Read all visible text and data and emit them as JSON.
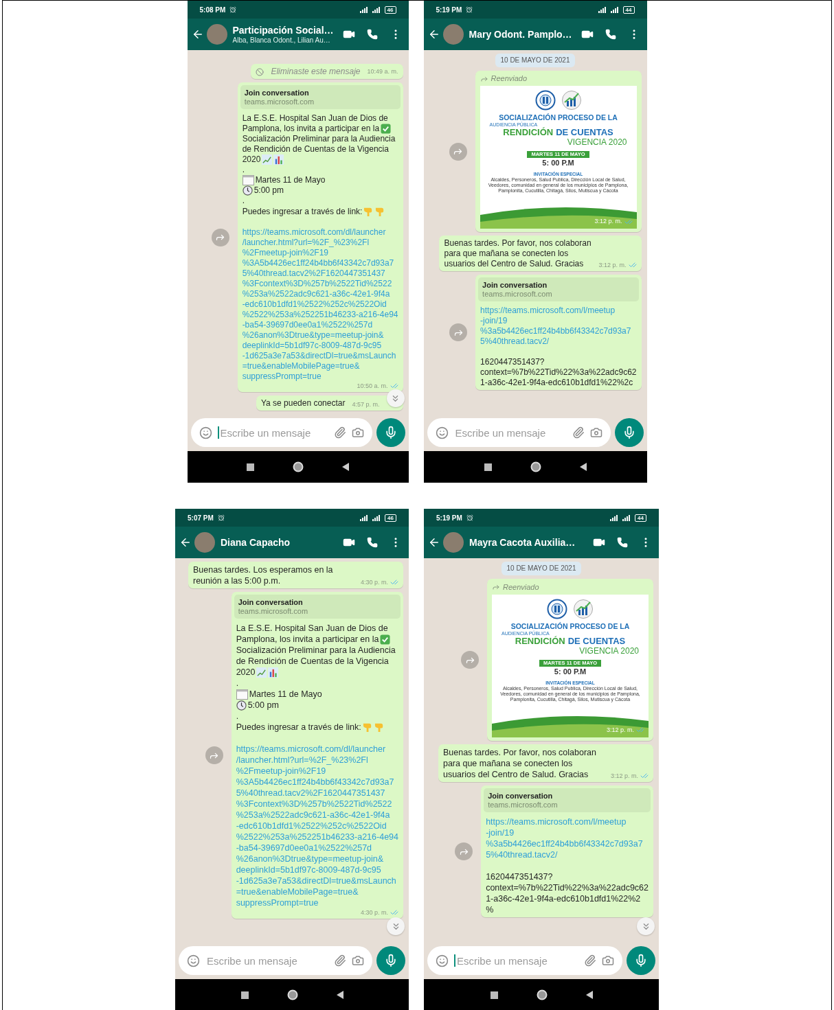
{
  "phones": [
    {
      "status_bar": {
        "time": "5:08 PM",
        "battery": "46"
      },
      "header": {
        "title": "Participación Social…",
        "subtitle": "Alba, Blanca Odont., Lilian Au…"
      },
      "messages": [
        {
          "kind": "deleted",
          "text": "Eliminaste este mensaje",
          "time": "10:49 a. m."
        },
        {
          "kind": "link",
          "forwardable": true,
          "preview": {
            "title": "Join conversation",
            "domain": "teams.microsoft.com"
          },
          "rows": [
            {
              "kind": "text",
              "text": "La E.S.E. Hospital San Juan de Dios de"
            },
            {
              "kind": "text",
              "text": "Pamplona, los invita a participar en la",
              "emoji": {
                "kind": "check"
              }
            },
            {
              "kind": "text",
              "text": "Socialización Preliminar para la Audiencia"
            },
            {
              "kind": "text",
              "text": "de Rendición de Cuentas de la Vigencia"
            },
            {
              "kind": "text",
              "text": "2020",
              "emoji": {
                "kind": "charts"
              }
            },
            {
              "kind": "text",
              "text": "."
            },
            {
              "kind": "text",
              "text": "Martes 11 de Mayo",
              "lead_emoji": {
                "kind": "calendar"
              }
            },
            {
              "kind": "text",
              "text": "5:00 pm",
              "lead_emoji": {
                "kind": "clock"
              }
            },
            {
              "kind": "text",
              "text": "."
            },
            {
              "kind": "text",
              "text": "Puedes ingresar a través de link:",
              "emoji": {
                "kind": "pointing"
              }
            },
            {
              "kind": "blank"
            },
            {
              "kind": "link",
              "lines": [
                "https://teams.microsoft.com/dl/launcher",
                "/launcher.html?url=%2F_%23%2Fl",
                "%2Fmeetup-join%2F19",
                "%3A5b4426ec1ff24b4bb6f43342c7d93a7",
                "5%40thread.tacv2%2F1620447351437",
                "%3Fcontext%3D%257b%2522Tid%2522",
                "%253a%2522adc9c621-a36c-42e1-9f4a",
                "-edc610b1dfd1%2522%252c%2522Oid",
                "%2522%253a%252251b46233-a216-4e94",
                "-ba54-39697d0ee0a1%2522%257d",
                "%26anon%3Dtrue&type=meetup-join&",
                "deeplinkId=5b1df97c-8009-487d-9c95",
                "-1d625a3e7a53&directDl=true&msLaunch",
                "=true&enableMobilePage=true&",
                "suppressPrompt=true"
              ]
            }
          ],
          "time": "10:50 a. m.",
          "read": true
        },
        {
          "kind": "text",
          "forwardable": false,
          "text": "Ya se pueden conectar",
          "time": "4:57 p. m."
        }
      ],
      "scroll_down_button": true,
      "composer": {
        "placeholder": "Escribe un mensaje",
        "focused": true
      }
    },
    {
      "status_bar": {
        "time": "5:19 PM",
        "battery": "44"
      },
      "header": {
        "title": "Mary Odont. Pamplo…"
      },
      "messages": [
        {
          "kind": "date",
          "text": "10 DE MAYO DE 2021"
        },
        {
          "kind": "image",
          "forwardable": true,
          "forwarded_label": "Reenviado",
          "poster": {
            "title": "SOCIALIZACIÓN PROCESO DE LA",
            "kicker": "AUDIENCIA PÚBLICA",
            "headline_green": "RENDICIÓN",
            "headline_blue": "DE CUENTAS",
            "subtitle": "VIGENCIA 2020",
            "date_badge": "MARTES 11 DE MAYO",
            "time": "5: 00 P.M",
            "invitation": "INVITACIÓN ESPECIAL",
            "audience": "Alcaldes, Personeros, Salud Publica, Dirección Local de Salud, Veedores, comunidad en general de los municipios de Pamplona, Pamplonita, Cucutilla, Chitagá, Silos, Mutiscua y Cácota"
          },
          "time": "3:12 p. m.",
          "read": true
        },
        {
          "kind": "text",
          "forwardable": false,
          "text": "Buenas tardes. Por favor, nos colaboran para que mañana se conecten los usuarios del Centro de Salud. Gracias",
          "time": "3:12 p. m.",
          "read": true
        },
        {
          "kind": "link",
          "forwardable": true,
          "preview": {
            "title": "Join conversation",
            "domain": "teams.microsoft.com"
          },
          "rows": [
            {
              "kind": "link",
              "lines": [
                "https://teams.microsoft.com/l/meetup",
                "-join/19",
                "%3a5b4426ec1ff24b4bb6f43342c7d93a7",
                "5%40thread.tacv2/"
              ]
            },
            {
              "kind": "blank"
            },
            {
              "kind": "text",
              "text": "1620447351437?"
            },
            {
              "kind": "text",
              "text": "context=%7b%22Tid%22%3a%22adc9c62"
            },
            {
              "kind": "text",
              "text": "1-a36c-42e1-9f4a-edc610b1dfd1%22%2c"
            }
          ]
        }
      ],
      "scroll_down_button": false,
      "composer": {
        "placeholder": "Escribe un mensaje",
        "focused": false
      }
    },
    {
      "status_bar": {
        "time": "5:07 PM",
        "battery": "46"
      },
      "header": {
        "title": "Diana Capacho"
      },
      "messages": [
        {
          "kind": "text",
          "forwardable": false,
          "text": "Buenas tardes. Los esperamos en la reunión a las 5:00 p.m.",
          "time": "4:30 p. m.",
          "read": true
        },
        {
          "kind": "link",
          "forwardable": true,
          "preview": {
            "title": "Join conversation",
            "domain": "teams.microsoft.com"
          },
          "rows": [
            {
              "kind": "text",
              "text": "La E.S.E. Hospital San Juan de Dios de"
            },
            {
              "kind": "text",
              "text": "Pamplona, los invita a participar en la",
              "emoji": {
                "kind": "check"
              }
            },
            {
              "kind": "text",
              "text": "Socialización Preliminar para la Audiencia"
            },
            {
              "kind": "text",
              "text": "de Rendición de Cuentas de la Vigencia"
            },
            {
              "kind": "text",
              "text": "2020",
              "emoji": {
                "kind": "charts"
              }
            },
            {
              "kind": "text",
              "text": "."
            },
            {
              "kind": "text",
              "text": "Martes 11 de Mayo",
              "lead_emoji": {
                "kind": "calendar"
              }
            },
            {
              "kind": "text",
              "text": "5:00 pm",
              "lead_emoji": {
                "kind": "clock"
              }
            },
            {
              "kind": "text",
              "text": "."
            },
            {
              "kind": "text",
              "text": "Puedes ingresar a través de link:",
              "emoji": {
                "kind": "pointing"
              }
            },
            {
              "kind": "blank"
            },
            {
              "kind": "link",
              "lines": [
                "https://teams.microsoft.com/dl/launcher",
                "/launcher.html?url=%2F_%23%2Fl",
                "%2Fmeetup-join%2F19",
                "%3A5b4426ec1ff24b4bb6f43342c7d93a7",
                "5%40thread.tacv2%2F1620447351437",
                "%3Fcontext%3D%257b%2522Tid%2522",
                "%253a%2522adc9c621-a36c-42e1-9f4a",
                "-edc610b1dfd1%2522%252c%2522Oid",
                "%2522%253a%252251b46233-a216-4e94",
                "-ba54-39697d0ee0a1%2522%257d",
                "%26anon%3Dtrue&type=meetup-join&",
                "deeplinkId=5b1df97c-8009-487d-9c95",
                "-1d625a3e7a53&directDl=true&msLaunch",
                "=true&enableMobilePage=true&",
                "suppressPrompt=true"
              ]
            }
          ],
          "time": "4:30 p. m.",
          "read": true
        }
      ],
      "scroll_down_button": true,
      "composer": {
        "placeholder": "Escribe un mensaje",
        "focused": false
      }
    },
    {
      "status_bar": {
        "time": "5:19 PM",
        "battery": "44"
      },
      "header": {
        "title": "Mayra Cacota Auxilia…"
      },
      "messages": [
        {
          "kind": "date",
          "text": "10 DE MAYO DE 2021"
        },
        {
          "kind": "image",
          "forwardable": true,
          "forwarded_label": "Reenviado",
          "poster": {
            "title": "SOCIALIZACIÓN PROCESO DE LA",
            "kicker": "AUDIENCIA PÚBLICA",
            "headline_green": "RENDICIÓN",
            "headline_blue": "DE CUENTAS",
            "subtitle": "VIGENCIA 2020",
            "date_badge": "MARTES 11 DE MAYO",
            "time": "5: 00 P.M",
            "invitation": "INVITACIÓN ESPECIAL",
            "audience": "Alcaldes, Personeros, Salud Publica, Dirección Local de Salud, Veedores, comunidad en general de los municipios de Pamplona, Pamplonita, Cucutilla, Chitagá, Silos, Mutiscua y Cácota"
          },
          "time": "3:12 p. m.",
          "read": true
        },
        {
          "kind": "text",
          "forwardable": false,
          "text": "Buenas tardes. Por favor, nos colaboran para que mañana se conecten los usuarios del Centro de Salud. Gracias",
          "time": "3:12 p. m.",
          "read": true
        },
        {
          "kind": "link",
          "forwardable": true,
          "preview": {
            "title": "Join conversation",
            "domain": "teams.microsoft.com"
          },
          "rows": [
            {
              "kind": "link",
              "lines": [
                "https://teams.microsoft.com/l/meetup",
                "-join/19",
                "%3a5b4426ec1ff24b4bb6f43342c7d93a7",
                "5%40thread.tacv2/"
              ]
            },
            {
              "kind": "blank"
            },
            {
              "kind": "text",
              "text": "1620447351437?"
            },
            {
              "kind": "text",
              "text": "context=%7b%22Tid%22%3a%22adc9c62"
            },
            {
              "kind": "text",
              "text": "1-a36c-42e1-9f4a-edc610b1dfd1%22%2"
            },
            {
              "kind": "text",
              "text": "%"
            }
          ]
        }
      ],
      "scroll_down_button": true,
      "composer": {
        "placeholder": "Escribe un mensaje",
        "focused": true
      }
    }
  ]
}
